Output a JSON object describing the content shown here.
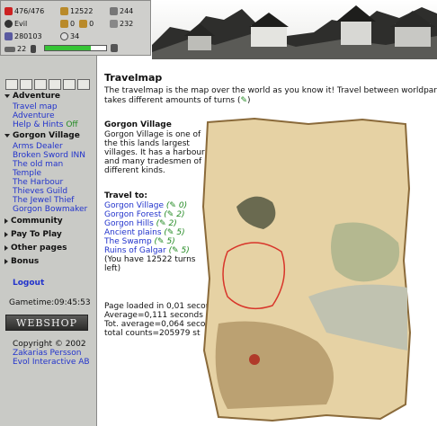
{
  "stats": {
    "health": "476/476",
    "gold": "12522",
    "swords": "244",
    "alignment": "Evil",
    "resource1": "0",
    "resource2": "0",
    "shield": "232",
    "experience": "280103",
    "kills": "34",
    "level": "22",
    "energy_fraction": 0.75
  },
  "sidebar": {
    "adventure": {
      "title": "Adventure",
      "items": [
        "Travel map",
        "Adventure",
        "Help & Hints"
      ],
      "hints_state": "Off"
    },
    "village": {
      "title": "Gorgon Village",
      "items": [
        "Arms Dealer",
        "Broken Sword INN",
        "The old man",
        "Temple",
        "The Harbour",
        "Thieves Guild",
        "The Jewel Thief",
        "Gorgon Bowmaker"
      ]
    },
    "sections": [
      "Community",
      "Pay To Play",
      "Other pages",
      "Bonus"
    ],
    "logout": "Logout",
    "gametime_label": "Gametime:",
    "gametime": "09:45:53",
    "webshop": "WEBSHOP",
    "copyright": [
      "Copyright © 2002",
      "Zakarias Persson",
      "Evol Interactive AB"
    ]
  },
  "main": {
    "title": "Travelmap",
    "intro1": "The travelmap is the map over the world as you know it! Travel between worldparts",
    "intro2": "takes different amounts of turns (",
    "intro2_end": ")",
    "location_title": "Gorgon Village",
    "location_desc": [
      "Gorgon Village is one of",
      "the this lands largest",
      "villages. It has a harbour",
      "and many tradesmen of",
      "different kinds."
    ],
    "travel_to": "Travel to:",
    "destinations": [
      {
        "name": "Gorgon Village",
        "turns": "0"
      },
      {
        "name": "Gorgon Forest",
        "turns": "2"
      },
      {
        "name": "Gorgon Hills",
        "turns": "2"
      },
      {
        "name": "Ancient plains",
        "turns": "5"
      },
      {
        "name": "The Swamp",
        "turns": "5"
      },
      {
        "name": "Ruins of Galgar",
        "turns": "5"
      }
    ],
    "turns_left_1": "(You have 12522 turns",
    "turns_left_2": "left)",
    "footer": [
      "Page loaded in 0,01 secon",
      "Average=0,111 seconds",
      "Tot. average=0,064 secor",
      "total counts=205979 st"
    ]
  },
  "colors": {
    "link": "#2233cc",
    "turns": "#238a23",
    "sidebar_bg": "#c9cac6"
  },
  "icons": [
    "heart-icon",
    "gold-icon",
    "sword-icon",
    "moon-icon",
    "shield-icon",
    "experience-icon",
    "skull-icon",
    "turn-icon"
  ]
}
